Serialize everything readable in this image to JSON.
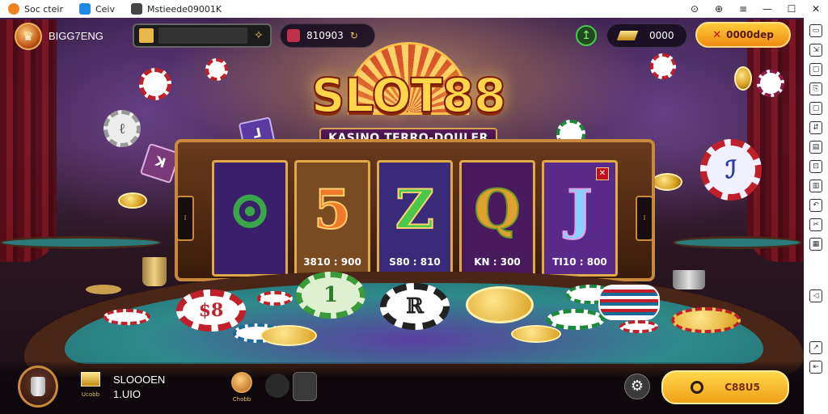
{
  "window": {
    "tabs": [
      {
        "label": "Soc cteir",
        "icon": "app-icon",
        "color": "#f08020"
      },
      {
        "label": "Ceiv",
        "icon": "cloud-icon",
        "color": "#1e88e5"
      },
      {
        "label": "Mstieede09001K",
        "icon": "window-icon",
        "color": "#444444"
      }
    ],
    "controls": [
      "⊙",
      "⊕",
      "≡",
      "—",
      "☐",
      "✕"
    ]
  },
  "hud": {
    "player_name": "BIGG7ENG",
    "search_placeholder": "",
    "balance": "810903",
    "level_icon": "arrow-up-icon",
    "gems": "0000",
    "cta_label": "0000dep",
    "cta_icon": "✕"
  },
  "logo": {
    "title": "SLOT88",
    "subtitle": "KASINO TERRO-DOULER"
  },
  "reels": [
    {
      "symbol": "⊙",
      "value": "",
      "bg": "#3a1f6a",
      "fg": "#3aa64a"
    },
    {
      "symbol": "5",
      "value": "3810 : 900",
      "bg": "#7a4a20",
      "fg": "#f07a2a"
    },
    {
      "symbol": "Z",
      "value": "S80 : 810",
      "bg": "#3a2a7a",
      "fg": "#4ac84a"
    },
    {
      "symbol": "Q",
      "value": "KN : 300",
      "bg": "#4a1a5e",
      "fg": "#e0a030"
    },
    {
      "symbol": "J",
      "value": "TI10 : 800",
      "bg": "#5a2a8a",
      "fg": "#8ad0ff"
    }
  ],
  "machine_side": {
    "left": "⁞",
    "right": "⁞"
  },
  "bottom": {
    "title": "SLOOOEN",
    "sub": "1.UIO",
    "bag_label": "Ucobb",
    "badge_label": "Chobb",
    "spin_label": "C88U5",
    "settings_icon": "gear-icon"
  },
  "sidebar_icons": [
    "▭",
    "⇲",
    "▢",
    "⎘",
    "▢",
    "⇵",
    "▤",
    "⊡",
    "▥",
    "↶",
    "✂",
    "▦",
    "◁",
    "↗",
    "⇤"
  ],
  "colors": {
    "accent": "#ffc23a",
    "felt": "#2e8a8a",
    "wood": "#c8893c"
  }
}
